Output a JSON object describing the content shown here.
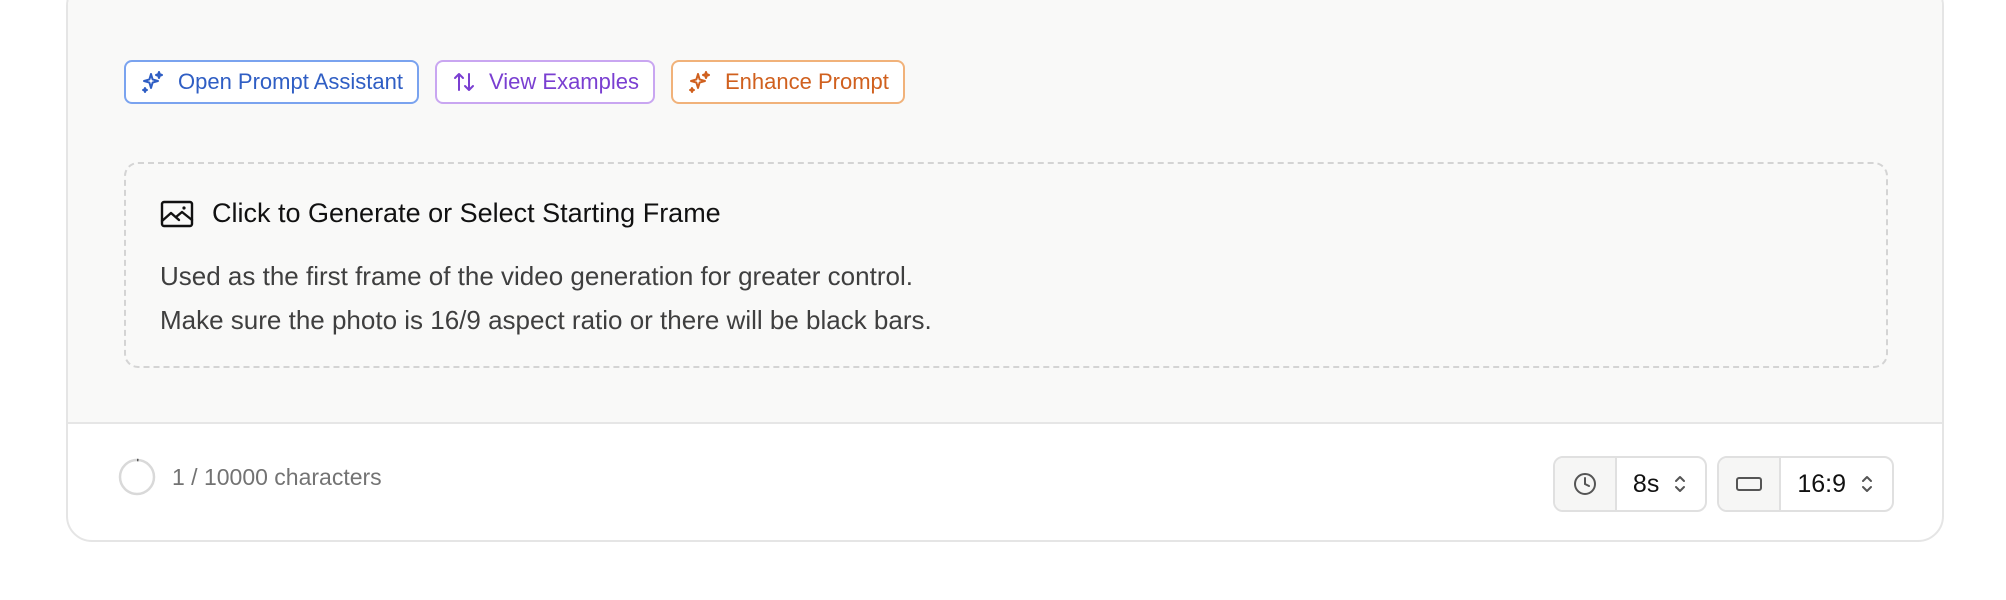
{
  "actions": {
    "open_prompt_assistant": "Open Prompt Assistant",
    "view_examples": "View Examples",
    "enhance_prompt": "Enhance Prompt"
  },
  "starting_frame": {
    "title": "Click to Generate or Select Starting Frame",
    "line1": "Used as the first frame of the video generation for greater control.",
    "line2": "Make sure the photo is 16/9 aspect ratio or there will be black bars."
  },
  "footer": {
    "char_count": "1 / 10000 characters",
    "char_progress": 0.0001,
    "duration": "8s",
    "aspect_ratio": "16:9"
  },
  "icons": {
    "assistant": "sparkles-icon",
    "examples": "arrows-up-down-icon",
    "enhance": "sparkles-icon",
    "frame": "image-icon",
    "duration": "clock-icon",
    "aspect": "rectangle-icon",
    "select": "chevron-up-down-icon"
  },
  "colors": {
    "blue": "#2f5ec4",
    "purple": "#7a3fd1",
    "orange": "#d0601e"
  }
}
